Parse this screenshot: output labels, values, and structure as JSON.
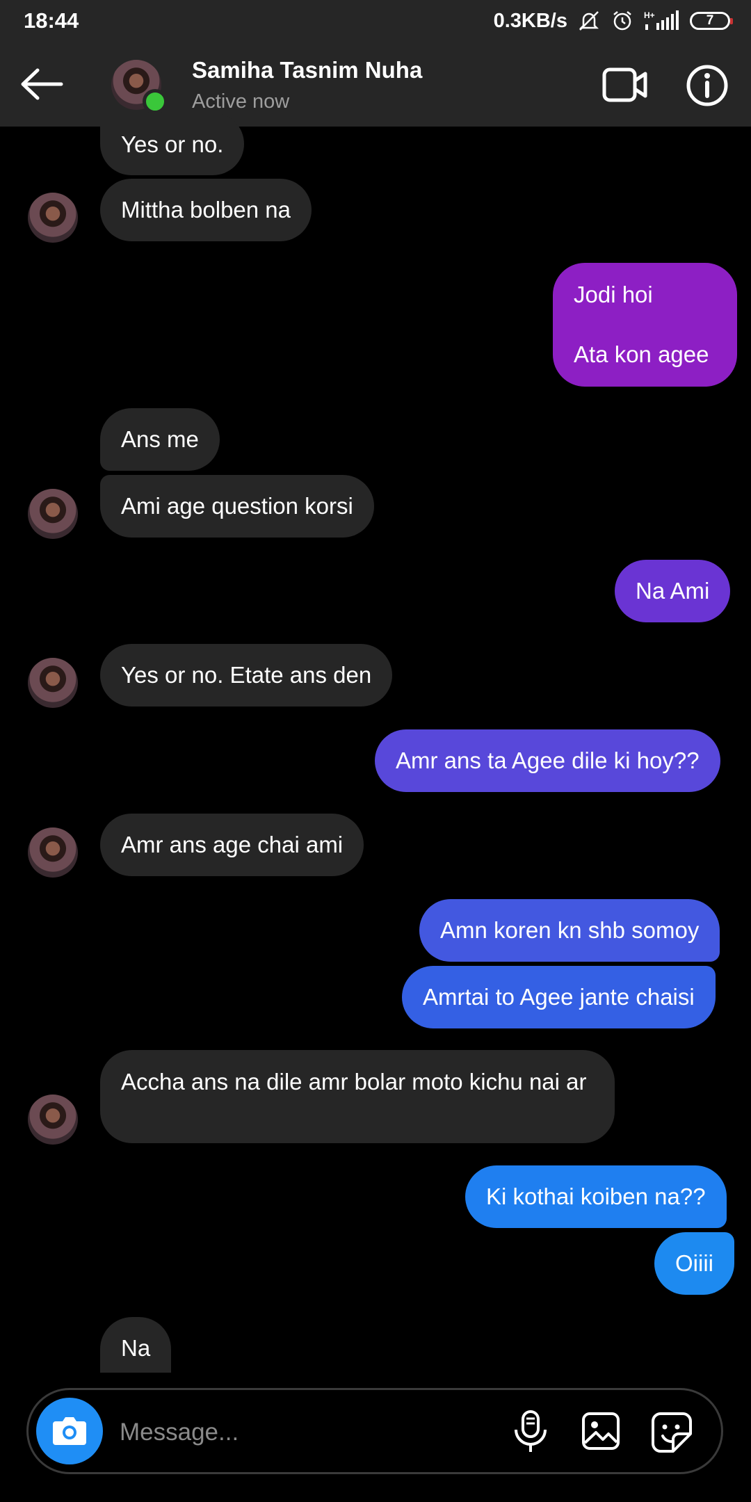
{
  "status_bar": {
    "time": "18:44",
    "net_speed": "0.3KB/s",
    "battery_level": "7",
    "icons": [
      "mute-icon",
      "alarm-icon",
      "signal-icon",
      "battery-icon"
    ]
  },
  "header": {
    "contact_name": "Samiha Tasnim Nuha",
    "contact_status": "Active now",
    "icons": [
      "back-arrow-icon",
      "video-call-icon",
      "info-icon"
    ]
  },
  "messages": [
    {
      "from": "them",
      "text": "Yes or no."
    },
    {
      "from": "them",
      "text": "Mittha bolben na"
    },
    {
      "from": "me",
      "text": "Jodi hoi\n\nAta kon agee"
    },
    {
      "from": "them",
      "text": "Ans me"
    },
    {
      "from": "them",
      "text": "Ami age question korsi"
    },
    {
      "from": "me",
      "text": "Na Ami"
    },
    {
      "from": "them",
      "text": "Yes or no. Etate ans den"
    },
    {
      "from": "me",
      "text": "Amr ans ta Agee dile ki hoy??"
    },
    {
      "from": "them",
      "text": "Amr ans age chai ami"
    },
    {
      "from": "me",
      "text": "Amn koren kn shb somoy"
    },
    {
      "from": "me",
      "text": "Amrtai to Agee jante chaisi"
    },
    {
      "from": "them",
      "text": "Accha ans na dile amr bolar moto kichu nai ar"
    },
    {
      "from": "me",
      "text": "Ki kothai koiben na??"
    },
    {
      "from": "me",
      "text": "Oiiii"
    },
    {
      "from": "them",
      "text": "Na"
    }
  ],
  "composer": {
    "placeholder": "Message...",
    "icons": [
      "camera-icon",
      "microphone-icon",
      "gallery-icon",
      "sticker-icon"
    ]
  },
  "colors": {
    "bar_background": "#262626",
    "incoming_bubble": "#262626",
    "outgoing_gradient": [
      "#8d1fc4",
      "#6a34d3",
      "#5848da",
      "#4358e0",
      "#1f7ff0",
      "#1d8af0"
    ],
    "online_dot": "#3ac73a",
    "camera_button": "#1f8ef5"
  }
}
